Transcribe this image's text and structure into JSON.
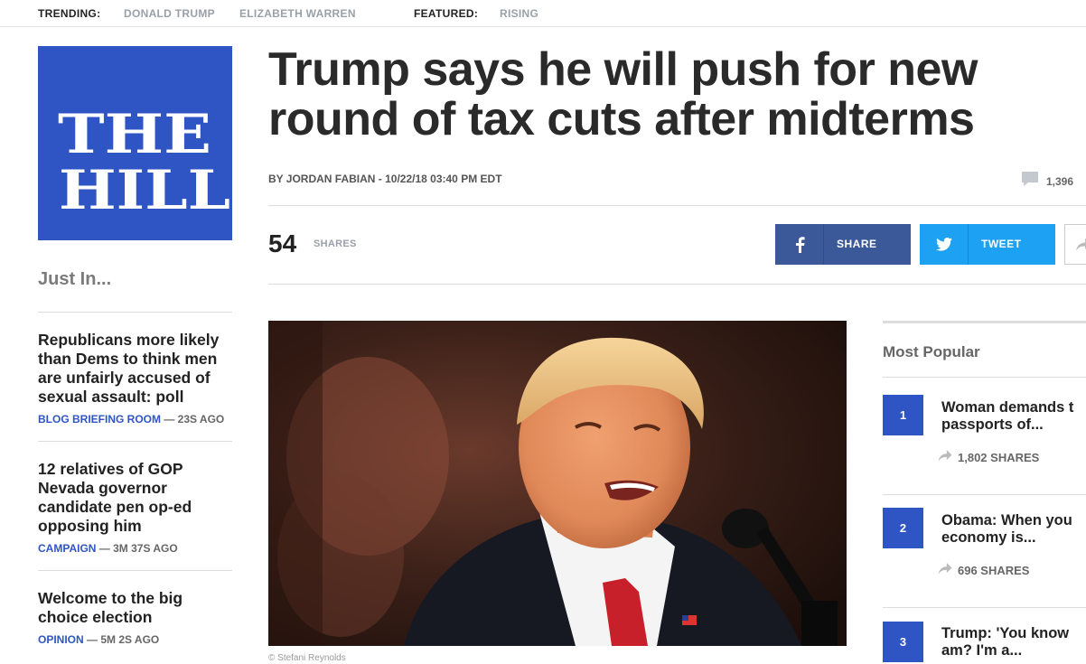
{
  "topbar": {
    "trending_label": "TRENDING:",
    "trending_links": [
      "DONALD TRUMP",
      "ELIZABETH WARREN"
    ],
    "featured_label": "FEATURED:",
    "featured_links": [
      "RISING"
    ]
  },
  "logo": {
    "line1": "THE",
    "line2": "HILL",
    "color": "#2f55c4"
  },
  "just_in": {
    "title": "Just In...",
    "stories": [
      {
        "title": "Republicans more likely than Dems to think men are unfairly accused of sexual assault: poll",
        "category": "BLOG BRIEFING ROOM",
        "time": "— 23S AGO"
      },
      {
        "title": "12 relatives of GOP Nevada governor candidate pen op-ed opposing him",
        "category": "CAMPAIGN",
        "time": "— 3M 37S AGO"
      },
      {
        "title": "Welcome to the big choice election",
        "category": "OPINION",
        "time": "— 5M 2S AGO"
      }
    ]
  },
  "article": {
    "headline": "Trump says he will push for new round of tax cuts after midterms",
    "byline": "BY JORDAN FABIAN - 10/22/18 03:40 PM EDT",
    "comment_count": "1,396",
    "share_count": "54",
    "share_label": "SHARES",
    "facebook_label": "SHARE",
    "twitter_label": "TWEET",
    "photo_credit": "© Stefani Reynolds"
  },
  "most_popular": {
    "title": "Most Popular",
    "items": [
      {
        "rank": "1",
        "headline": "Woman demands t\npassports of...",
        "shares": "1,802 SHARES"
      },
      {
        "rank": "2",
        "headline": "Obama: When you\neconomy is...",
        "shares": "696 SHARES"
      },
      {
        "rank": "3",
        "headline": "Trump: 'You know\nam? I'm a...",
        "shares": ""
      }
    ]
  },
  "colors": {
    "brand_blue": "#2f55c4",
    "facebook": "#3b5998",
    "twitter": "#1da1f2"
  }
}
